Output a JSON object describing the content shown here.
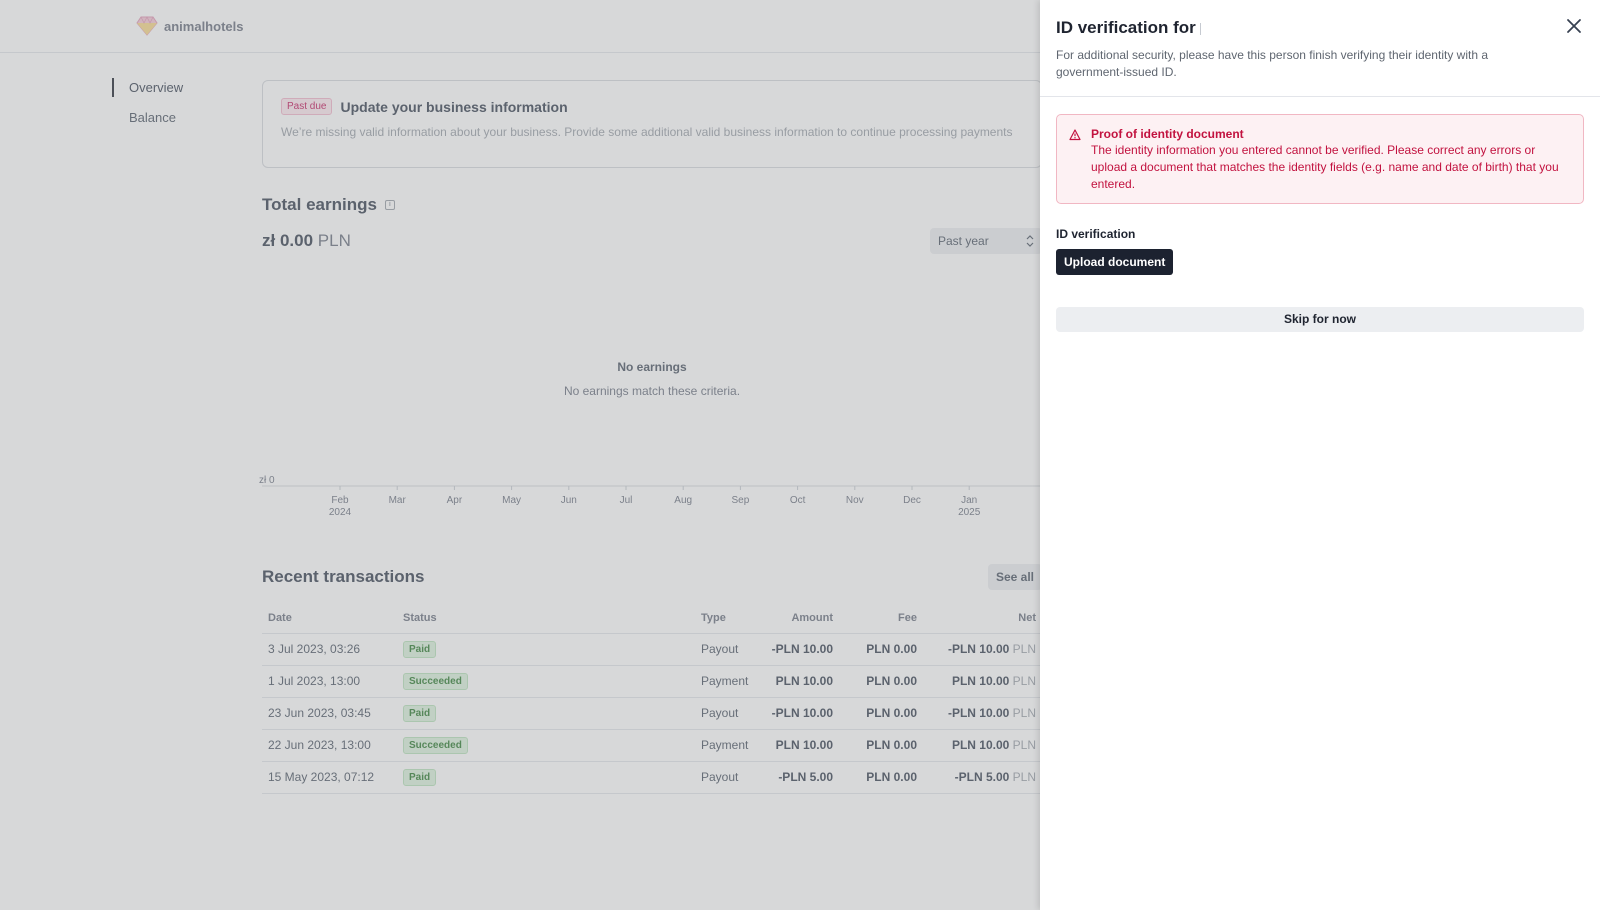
{
  "app": {
    "brand": "animalhotels",
    "nav": [
      {
        "label": "Overview",
        "active": true
      },
      {
        "label": "Balance",
        "active": false
      }
    ]
  },
  "alert": {
    "badge": "Past due",
    "title": "Update your business information",
    "text": "We’re missing valid information about your business. Provide some additional valid business information to continue processing payments"
  },
  "earnings": {
    "title": "Total earnings",
    "amount": "zł 0.00",
    "currency": "PLN",
    "period": "Past year",
    "empty_title": "No earnings",
    "empty_text": "No earnings match these criteria.",
    "y_label": "zł 0",
    "x_ticks": [
      {
        "label": "Feb",
        "sub": "2024"
      },
      {
        "label": "Mar",
        "sub": ""
      },
      {
        "label": "Apr",
        "sub": ""
      },
      {
        "label": "May",
        "sub": ""
      },
      {
        "label": "Jun",
        "sub": ""
      },
      {
        "label": "Jul",
        "sub": ""
      },
      {
        "label": "Aug",
        "sub": ""
      },
      {
        "label": "Sep",
        "sub": ""
      },
      {
        "label": "Oct",
        "sub": ""
      },
      {
        "label": "Nov",
        "sub": ""
      },
      {
        "label": "Dec",
        "sub": ""
      },
      {
        "label": "Jan",
        "sub": "2025"
      }
    ]
  },
  "transactions": {
    "title": "Recent transactions",
    "see_all": "See all",
    "columns": [
      "Date",
      "Status",
      "Type",
      "Amount",
      "Fee",
      "Net"
    ],
    "rows": [
      {
        "date": "3 Jul 2023, 03:26",
        "status": "Paid",
        "type": "Payout",
        "amount": "-PLN 10.00",
        "fee": "PLN 0.00",
        "net": "-PLN 10.00",
        "net_cur": "PLN"
      },
      {
        "date": "1 Jul 2023, 13:00",
        "status": "Succeeded",
        "type": "Payment",
        "amount": "PLN 10.00",
        "fee": "PLN 0.00",
        "net": "PLN 10.00",
        "net_cur": "PLN"
      },
      {
        "date": "23 Jun 2023, 03:45",
        "status": "Paid",
        "type": "Payout",
        "amount": "-PLN 10.00",
        "fee": "PLN 0.00",
        "net": "-PLN 10.00",
        "net_cur": "PLN"
      },
      {
        "date": "22 Jun 2023, 13:00",
        "status": "Succeeded",
        "type": "Payment",
        "amount": "PLN 10.00",
        "fee": "PLN 0.00",
        "net": "PLN 10.00",
        "net_cur": "PLN"
      },
      {
        "date": "15 May 2023, 07:12",
        "status": "Paid",
        "type": "Payout",
        "amount": "-PLN 5.00",
        "fee": "PLN 0.00",
        "net": "-PLN 5.00",
        "net_cur": "PLN"
      }
    ]
  },
  "drawer": {
    "title": "ID verification for",
    "description": "For additional security, please have this person finish verifying their identity with a government-issued ID.",
    "error_title": "Proof of identity document",
    "error_text": "The identity information you entered cannot be verified. Please correct any errors or upload a document that matches the identity fields (e.g. name and date of birth) that you entered.",
    "section_label": "ID verification",
    "upload_label": "Upload document",
    "skip_label": "Skip for now",
    "close_icon": "close-icon",
    "error_icon": "warning-icon"
  },
  "colors": {
    "error": "#c2123f",
    "error_bg": "#fdf1f3",
    "primary_button": "#1c2230",
    "success_pill": "#dcf3dd"
  }
}
